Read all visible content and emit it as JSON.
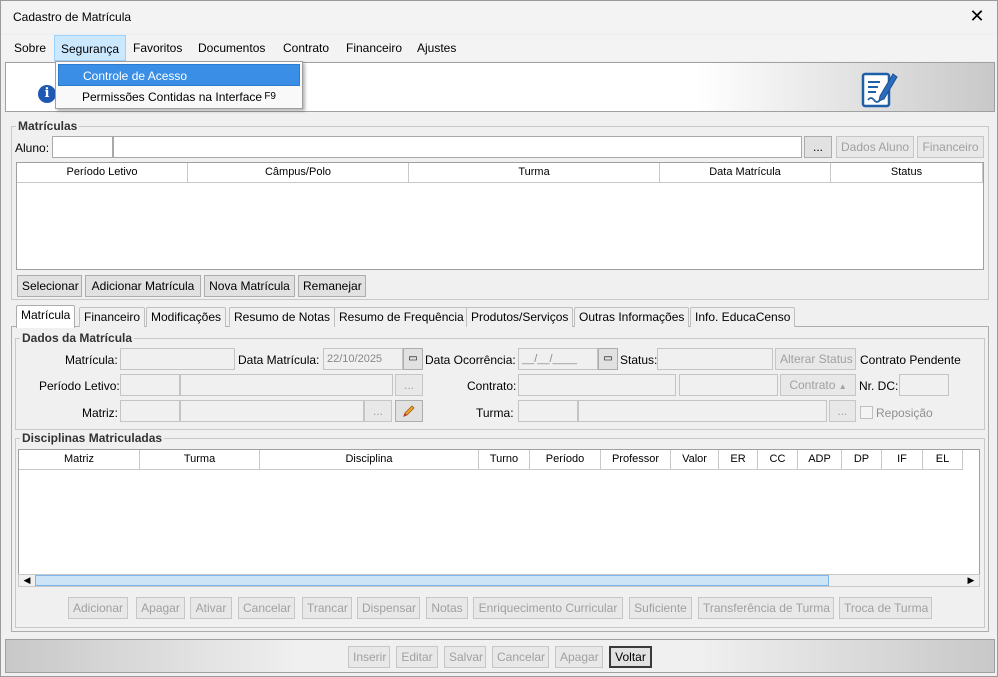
{
  "window": {
    "title": "Cadastro de Matrícula",
    "close": "✕"
  },
  "menu": [
    "Sobre",
    "Segurança",
    "Favoritos",
    "Documentos",
    "Contrato",
    "Financeiro",
    "Ajustes"
  ],
  "dropdown": {
    "items": [
      {
        "label": "Controle de Acesso",
        "shortcut": ""
      },
      {
        "label": "Permissões Contidas na Interface",
        "shortcut": "F9"
      }
    ]
  },
  "banner": {
    "info_glyph": "i"
  },
  "matriculas": {
    "title": "Matrículas",
    "aluno_label": "Aluno:",
    "ellipsis": "...",
    "dados_aluno": "Dados Aluno",
    "financeiro": "Financeiro",
    "columns": [
      "Período Letivo",
      "Câmpus/Polo",
      "Turma",
      "Data Matrícula",
      "Status"
    ],
    "buttons": [
      "Selecionar",
      "Adicionar Matrícula",
      "Nova Matrícula",
      "Remanejar"
    ]
  },
  "tabs": [
    "Matrícula",
    "Financeiro",
    "Modificações",
    "Resumo de Notas",
    "Resumo de Frequência",
    "Produtos/Serviços",
    "Outras Informações",
    "Info. EducaCenso"
  ],
  "dados": {
    "title": "Dados da Matrícula",
    "matricula": "Matrícula:",
    "data_matricula": "Data Matrícula:",
    "data_matricula_value": "22/10/2025",
    "data_ocorrencia": "Data Ocorrência:",
    "data_ocorrencia_value": "__/__/____",
    "status": "Status:",
    "alterar_status": "Alterar Status",
    "contrato_pendente": "Contrato Pendente",
    "periodo_letivo": "Período Letivo:",
    "contrato": "Contrato:",
    "contrato_btn": "Contrato",
    "nr_dc": "Nr. DC:",
    "matriz": "Matriz:",
    "turma": "Turma:",
    "reposicao": "Reposição",
    "ellipsis": "..."
  },
  "disciplinas": {
    "title": "Disciplinas Matriculadas",
    "columns": [
      "Matriz",
      "Turma",
      "Disciplina",
      "Turno",
      "Período",
      "Professor",
      "Valor",
      "ER",
      "CC",
      "ADP",
      "DP",
      "IF",
      "EL"
    ],
    "buttons": [
      "Adicionar",
      "Apagar",
      "Ativar",
      "Cancelar",
      "Trancar",
      "Dispensar",
      "Notas",
      "Enriquecimento Curricular",
      "Suficiente",
      "Transferência de Turma",
      "Troca de Turma"
    ]
  },
  "footer": {
    "buttons": [
      "Inserir",
      "Editar",
      "Salvar",
      "Cancelar",
      "Apagar",
      "Voltar"
    ]
  }
}
